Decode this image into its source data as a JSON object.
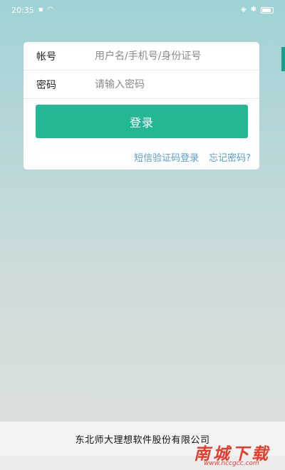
{
  "status_bar": {
    "time": "20:35"
  },
  "login_form": {
    "account_label": "帐号",
    "account_placeholder": "用户名/手机号/身份证号",
    "password_label": "密码",
    "password_placeholder": "请输入密码",
    "login_button": "登录",
    "sms_login_link": "短信验证码登录",
    "forgot_password_link": "忘记密码?"
  },
  "footer": {
    "company_name": "东北师大理想软件股份有限公司"
  },
  "watermark": {
    "text": "南城下载",
    "url": "www.nccgcc.com"
  },
  "colors": {
    "accent": "#23b793",
    "link": "#5a9bd0",
    "watermark": "#e83a2a"
  }
}
